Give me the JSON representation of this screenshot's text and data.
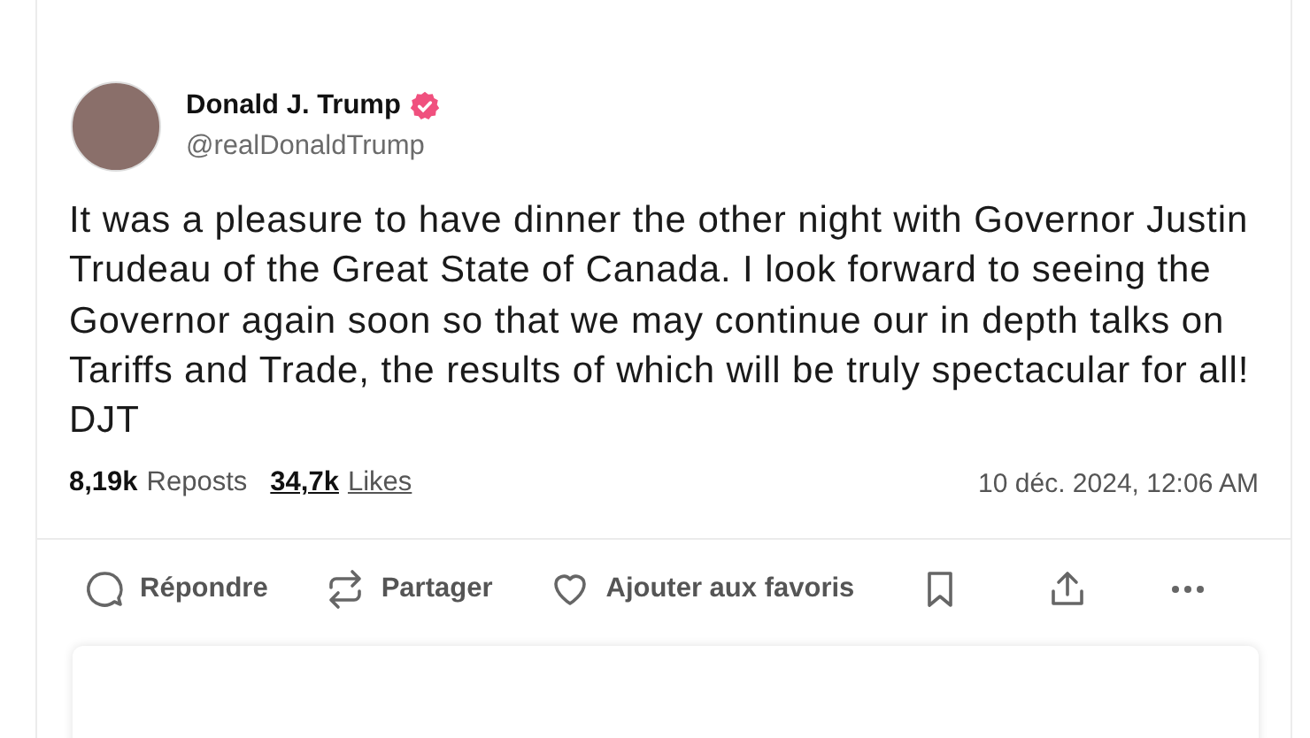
{
  "post": {
    "author": {
      "name": "Donald J. Trump",
      "verified": true,
      "handle": "@realDonaldTrump"
    },
    "body": "It was a pleasure to have dinner the other night with Governor Justin Trudeau of the Great State of Canada. I look forward to seeing the Governor again soon so that we may continue our in depth talks on Tariffs and Trade, the results of which will be truly spectacular for all! DJT",
    "stats": [
      {
        "count": "8,19k",
        "label": "Reposts",
        "link": false
      },
      {
        "count": "34,7k",
        "label": "Likes",
        "link": true
      }
    ],
    "timestamp": "10 déc. 2024, 12:06 AM",
    "actions": [
      {
        "kind": "reply",
        "label": "Répondre"
      },
      {
        "kind": "repost",
        "label": "Partager"
      },
      {
        "kind": "favorite",
        "label": "Ajouter aux favoris"
      },
      {
        "kind": "bookmark"
      },
      {
        "kind": "share"
      },
      {
        "kind": "more"
      }
    ]
  }
}
